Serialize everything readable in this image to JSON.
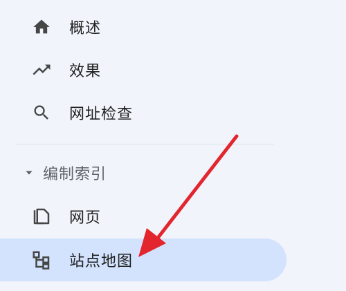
{
  "nav": {
    "items": [
      {
        "label": "概述",
        "icon": "home-icon"
      },
      {
        "label": "效果",
        "icon": "trending-up-icon"
      },
      {
        "label": "网址检查",
        "icon": "search-icon"
      }
    ],
    "section": {
      "label": "编制索引",
      "icon": "caret-down-icon",
      "expanded": true,
      "items": [
        {
          "label": "网页",
          "icon": "pages-copy-icon",
          "selected": false
        },
        {
          "label": "站点地图",
          "icon": "sitemap-icon",
          "selected": true
        }
      ]
    }
  },
  "colors": {
    "background": "#f1f4fb",
    "selected_background": "#d3e3fd",
    "icon": "#444746",
    "annotation_arrow": "#e3262e"
  }
}
